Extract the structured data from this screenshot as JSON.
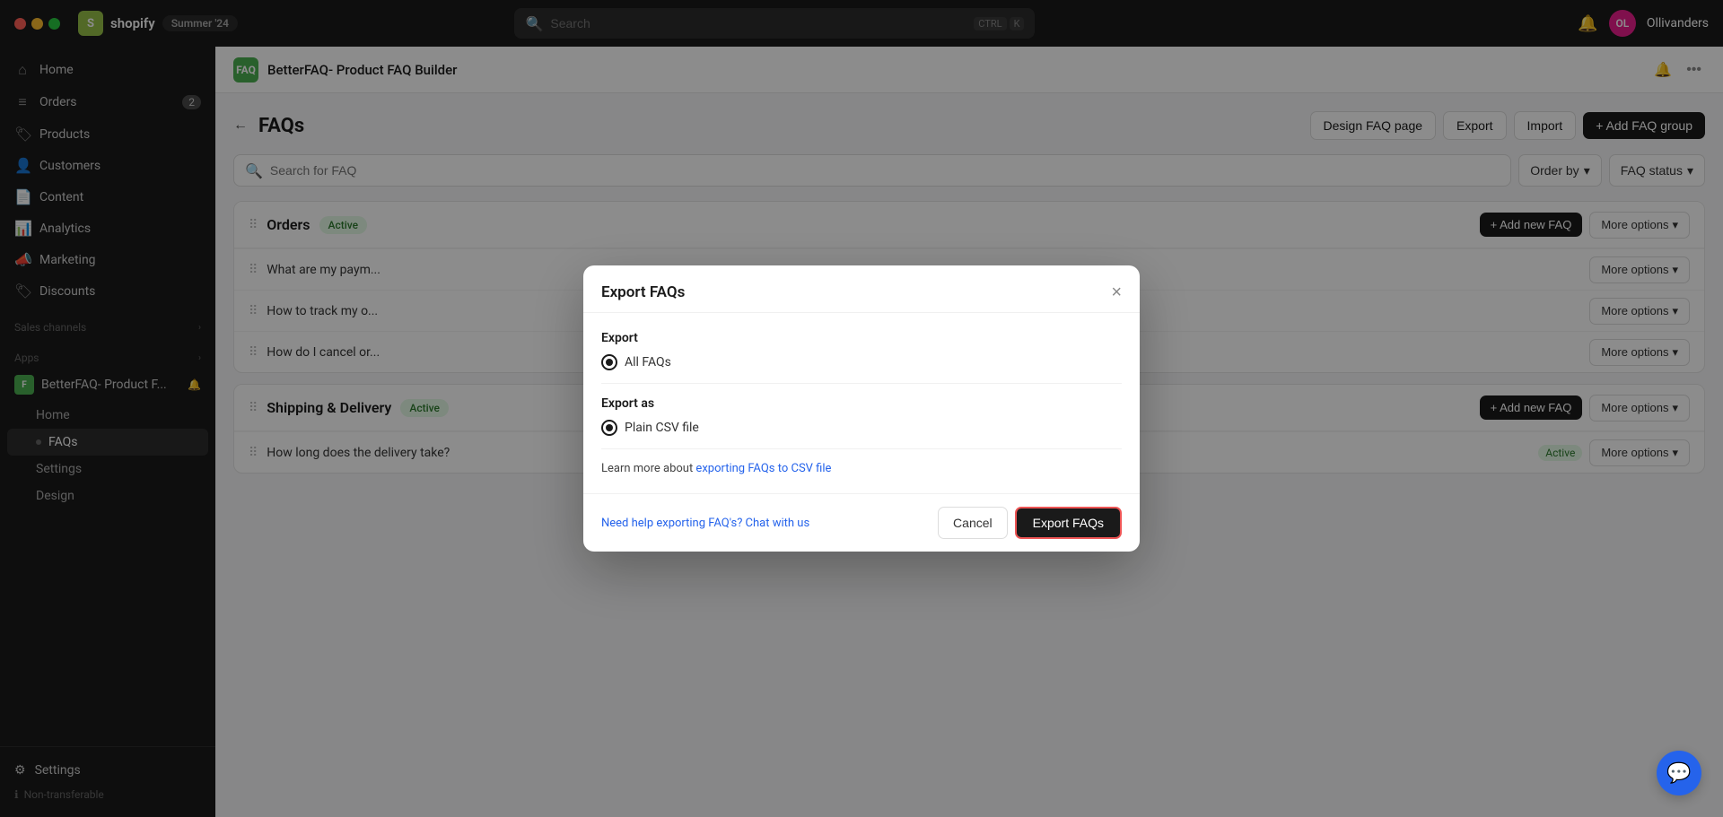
{
  "topbar": {
    "shopify_label": "shopify",
    "shopify_icon_letter": "S",
    "summer_badge": "Summer '24",
    "search_placeholder": "Search",
    "search_shortcut_1": "CTRL",
    "search_shortcut_2": "K",
    "user_initials": "OL",
    "user_name": "Ollivanders"
  },
  "sidebar": {
    "nav_items": [
      {
        "id": "home",
        "icon": "⌂",
        "label": "Home"
      },
      {
        "id": "orders",
        "icon": "📋",
        "label": "Orders",
        "badge": "2"
      },
      {
        "id": "products",
        "icon": "🏷",
        "label": "Products"
      },
      {
        "id": "customers",
        "icon": "👤",
        "label": "Customers"
      },
      {
        "id": "content",
        "icon": "📄",
        "label": "Content"
      },
      {
        "id": "analytics",
        "icon": "📊",
        "label": "Analytics"
      },
      {
        "id": "marketing",
        "icon": "📣",
        "label": "Marketing"
      },
      {
        "id": "discounts",
        "icon": "🏷",
        "label": "Discounts"
      }
    ],
    "sales_channels_label": "Sales channels",
    "apps_label": "Apps",
    "app_name": "BetterFAQ- Product F...",
    "app_subnav": [
      {
        "id": "app-home",
        "label": "Home"
      },
      {
        "id": "app-faqs",
        "label": "FAQs",
        "active": true
      },
      {
        "id": "app-settings",
        "label": "Settings"
      },
      {
        "id": "app-design",
        "label": "Design"
      }
    ],
    "settings_label": "Settings",
    "non_transferable_label": "Non-transferable"
  },
  "app_header": {
    "icon_letters": "FAQ",
    "title": "BetterFAQ- Product FAQ Builder"
  },
  "page": {
    "back_label": "←",
    "title": "FAQs",
    "actions": {
      "design": "Design FAQ page",
      "export": "Export",
      "import": "Import",
      "add_group": "+ Add FAQ group"
    },
    "search_placeholder": "Search for FAQ",
    "order_by_label": "Order by",
    "faq_status_label": "FAQ status"
  },
  "faq_groups": [
    {
      "id": "orders-group",
      "title": "Orders",
      "status": "Active",
      "status_color": "active",
      "add_btn": "+ Add new FAQ",
      "more_btn": "More options",
      "items": [
        {
          "question": "What are my paym...",
          "status": null
        },
        {
          "question": "How to track my o...",
          "status": null
        },
        {
          "question": "How do I cancel or...",
          "status": null
        }
      ]
    },
    {
      "id": "shipping-group",
      "title": "Shipping & Delivery",
      "status": "Active",
      "status_color": "active",
      "add_btn": "+ Add new FAQ",
      "more_btn": "More options",
      "items": [
        {
          "question": "How long does the delivery take?",
          "status": "Active"
        }
      ]
    }
  ],
  "modal": {
    "title": "Export FAQs",
    "close_label": "×",
    "export_section_label": "Export",
    "export_options": [
      {
        "id": "all-faqs",
        "label": "All FAQs",
        "checked": true
      }
    ],
    "export_as_label": "Export as",
    "export_as_options": [
      {
        "id": "plain-csv",
        "label": "Plain CSV file",
        "checked": true
      }
    ],
    "learn_more_text": "Learn more about ",
    "learn_more_link_text": "exporting FAQs to CSV file",
    "learn_more_link": "#",
    "help_text": "Need help exporting FAQ's? Chat with us",
    "cancel_label": "Cancel",
    "export_label": "Export FAQs"
  },
  "chat_icon": "💬"
}
